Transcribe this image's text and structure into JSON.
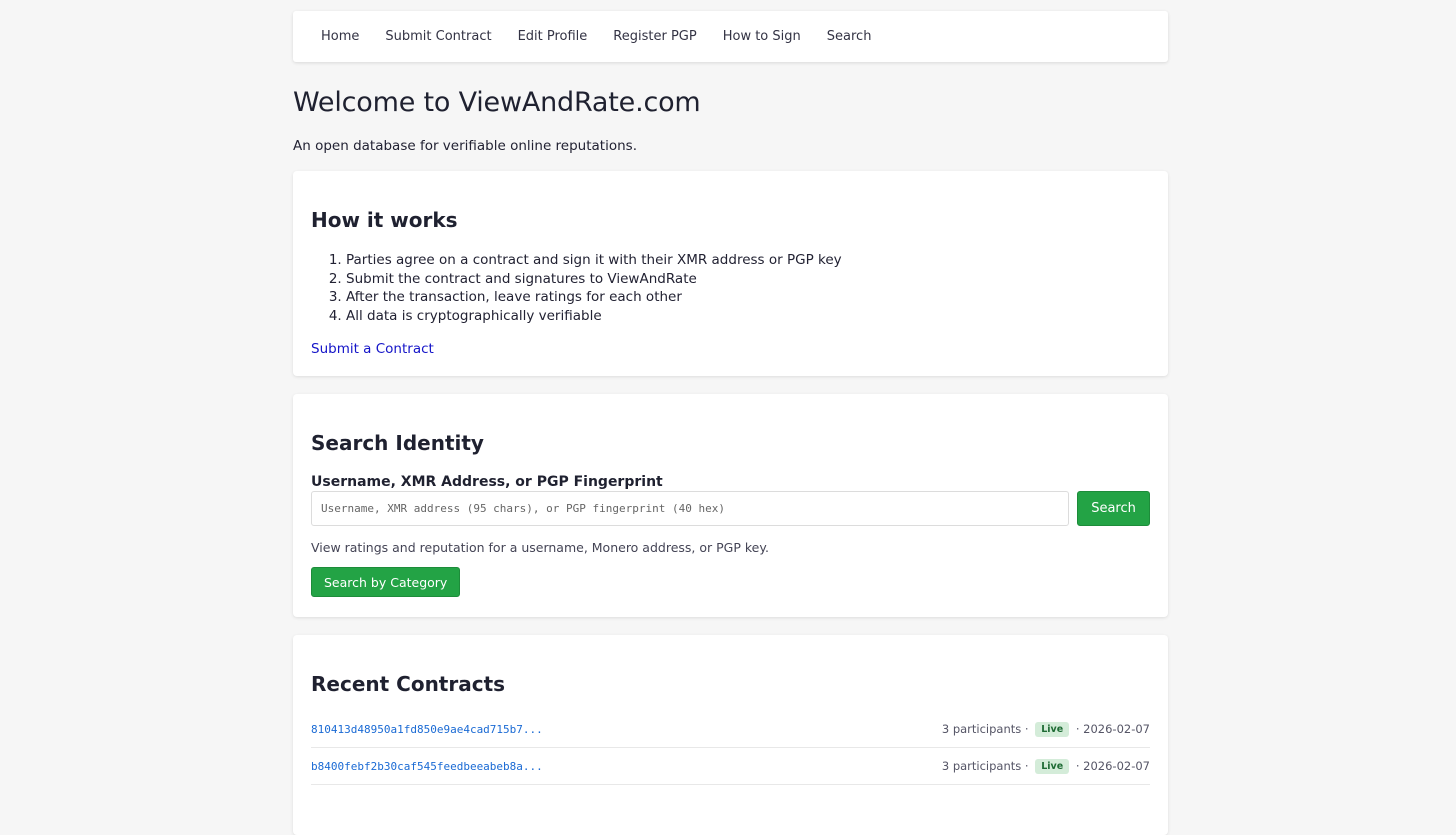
{
  "nav": {
    "items": [
      {
        "label": "Home"
      },
      {
        "label": "Submit Contract"
      },
      {
        "label": "Edit Profile"
      },
      {
        "label": "Register PGP"
      },
      {
        "label": "How to Sign"
      },
      {
        "label": "Search"
      }
    ]
  },
  "hero": {
    "title": "Welcome to ViewAndRate.com",
    "tagline": "An open database for verifiable online reputations."
  },
  "how": {
    "title": "How it works",
    "steps": [
      "Parties agree on a contract and sign it with their XMR address or PGP key",
      "Submit the contract and signatures to ViewAndRate",
      "After the transaction, leave ratings for each other",
      "All data is cryptographically verifiable"
    ],
    "link_label": "Submit a Contract"
  },
  "search": {
    "title": "Search Identity",
    "field_label": "Username, XMR Address, or PGP Fingerprint",
    "placeholder": "Username, XMR address (95 chars), or PGP fingerprint (40 hex)",
    "value": "",
    "button_label": "Search",
    "help": "View ratings and reputation for a username, Monero address, or PGP key.",
    "category_button_label": "Search by Category"
  },
  "recent": {
    "title": "Recent Contracts",
    "contracts": [
      {
        "hash": "810413d48950a1fd850e9ae4cad715b7...",
        "participants": "3 participants",
        "status": "Live",
        "date": "2026-02-07"
      },
      {
        "hash": "b8400febf2b30caf545feedbeeabeb8a...",
        "participants": "3 participants",
        "status": "Live",
        "date": "2026-02-07"
      }
    ]
  },
  "colors": {
    "accent_green": "#23a345",
    "link_blue": "#1414c8",
    "hash_blue": "#1a6ad4",
    "badge_bg": "#d4ecd9"
  }
}
